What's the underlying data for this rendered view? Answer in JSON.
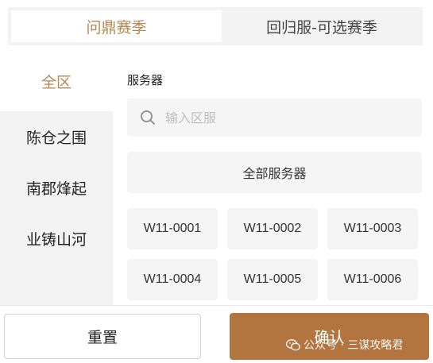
{
  "tabs": [
    {
      "label": "问鼎赛季",
      "active": true
    },
    {
      "label": "回归服-可选赛季",
      "active": false
    }
  ],
  "sidebar": {
    "items": [
      {
        "label": "全区",
        "active": true
      },
      {
        "label": "陈仓之围",
        "active": false
      },
      {
        "label": "南郡烽起",
        "active": false
      },
      {
        "label": "业铸山河",
        "active": false
      }
    ]
  },
  "main": {
    "section_title": "服务器",
    "search": {
      "placeholder": "输入区服",
      "value": ""
    },
    "all_servers_label": "全部服务器",
    "servers": [
      "W11-0001",
      "W11-0002",
      "W11-0003",
      "W11-0004",
      "W11-0005",
      "W11-0006"
    ]
  },
  "footer": {
    "reset_label": "重置",
    "confirm_label": "确认"
  },
  "watermark": {
    "text": "公众号 · 三谋攻略君"
  },
  "colors": {
    "accent": "#b8864f",
    "confirm_bg": "#b3753f",
    "panel_bg": "#f3f3f3"
  },
  "icons": [
    "search-icon",
    "wechat-icon"
  ]
}
